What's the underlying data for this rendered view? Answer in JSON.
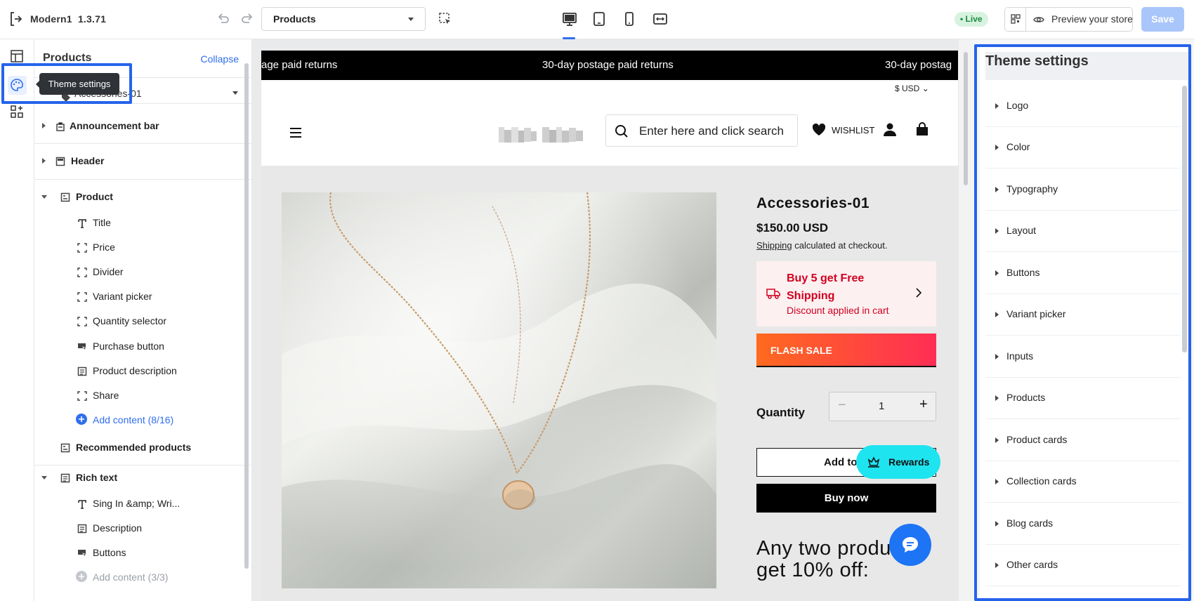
{
  "app": {
    "name": "Modern1",
    "version": "1.3.71"
  },
  "toolbar": {
    "page_select": "Products",
    "live_badge": "Live",
    "preview_label": "Preview your store",
    "save_label": "Save"
  },
  "icons": {
    "exit": "exit-icon",
    "undo": "undo-icon",
    "redo": "redo-icon",
    "inspect": "inspect-icon",
    "desktop": "desktop-icon",
    "tablet": "tablet-icon",
    "mobile": "mobile-icon",
    "fullwidth": "fullwidth-icon",
    "qr": "qr-code-icon",
    "eye": "eye-icon"
  },
  "colors": {
    "accent": "#2f6fed",
    "highlight": "#2563eb",
    "promo_red": "#d1001f",
    "rewards": "#1ee4f0"
  },
  "tooltip": "Theme settings",
  "left_panel": {
    "title": "Products",
    "collapse": "Collapse",
    "selected_product": "Accessories-01",
    "sections": [
      {
        "label": "Announcement bar"
      },
      {
        "label": "Header"
      },
      {
        "label": "Product"
      },
      {
        "label": "Recommended products"
      },
      {
        "label": "Rich text"
      }
    ],
    "product_blocks": [
      "Title",
      "Price",
      "Divider",
      "Variant picker",
      "Quantity selector",
      "Purchase button",
      "Product description",
      "Share"
    ],
    "product_add": "Add content (8/16)",
    "richtext_blocks": [
      "Sing In &amp; Wri...",
      "Description",
      "Buttons"
    ],
    "richtext_add": "Add content (3/3)"
  },
  "store": {
    "announcement": [
      "age paid returns",
      "30-day postage paid returns",
      "30-day postag"
    ],
    "currency": "$ USD",
    "search_placeholder": "Enter here and click search",
    "wishlist": "WISHLIST",
    "product_title": "Accessories-01",
    "price": "$150.00 USD",
    "shipping_link": "Shipping",
    "shipping_rest": " calculated at checkout.",
    "promo_title": "Buy 5 get Free Shipping",
    "promo_sub": "Discount applied in cart",
    "flash": "FLASH SALE",
    "quantity_label": "Quantity",
    "quantity_value": "1",
    "add_to_cart": "Add to c",
    "buy_now": "Buy now",
    "rewards": "Rewards",
    "offer": "Any two products get 10% off:"
  },
  "theme_settings": {
    "title": "Theme settings",
    "items": [
      "Logo",
      "Color",
      "Typography",
      "Layout",
      "Buttons",
      "Variant picker",
      "Inputs",
      "Products",
      "Product cards",
      "Collection cards",
      "Blog cards",
      "Other cards"
    ]
  }
}
